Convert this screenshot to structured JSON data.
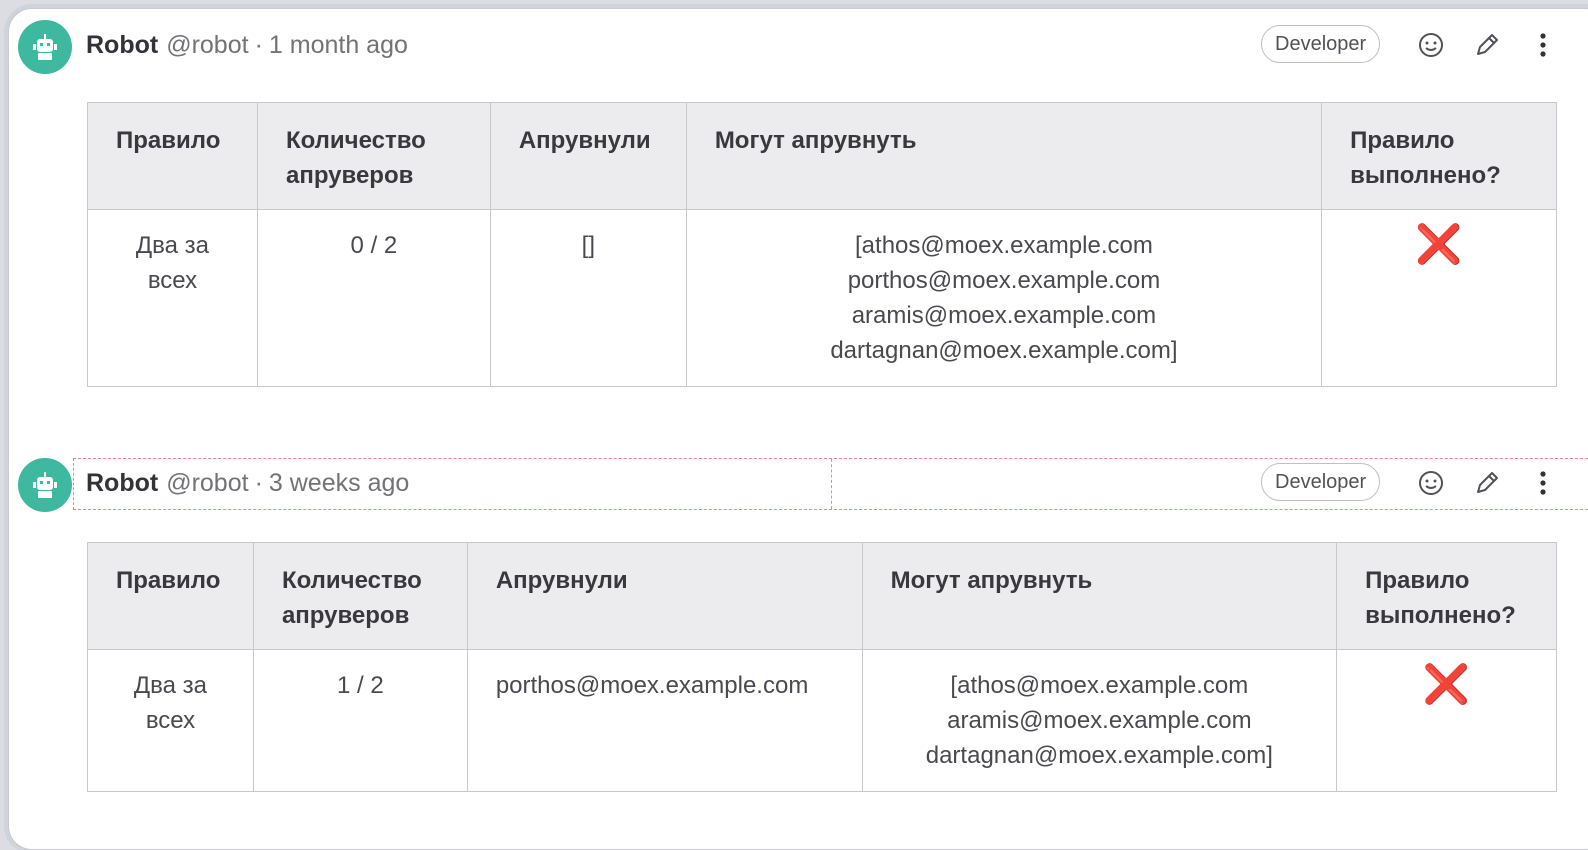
{
  "notes": [
    {
      "author": "Robot",
      "handle": "@robot",
      "separator": "·",
      "time": "1 month ago",
      "role": "Developer",
      "table": {
        "headers": [
          "Правило",
          "Количество апруверов",
          "Апрувнули",
          "Могут апрувнуть",
          "Правило выполнено?"
        ],
        "row": {
          "rule": "Два за всех",
          "count": "0 / 2",
          "approved": "[]",
          "can_approve": [
            "[athos@moex.example.com",
            "porthos@moex.example.com",
            "aramis@moex.example.com",
            "dartagnan@moex.example.com]"
          ],
          "done": "❌"
        }
      }
    },
    {
      "author": "Robot",
      "handle": "@robot",
      "separator": "·",
      "time": "3 weeks ago",
      "role": "Developer",
      "table": {
        "headers": [
          "Правило",
          "Количество апруверов",
          "Апрувнули",
          "Могут апрувнуть",
          "Правило выполнено?"
        ],
        "row": {
          "rule": "Два за всех",
          "count": "1 / 2",
          "approved": "porthos@moex.example.com",
          "can_approve": [
            "[athos@moex.example.com",
            "aramis@moex.example.com",
            "dartagnan@moex.example.com]"
          ],
          "done": "❌"
        }
      }
    }
  ],
  "colors": {
    "avatar": "#3fb8a0",
    "cross": "#d93b1d",
    "header_bg": "#ececef"
  },
  "icons": [
    "robot-avatar-icon",
    "emoji-icon",
    "pencil-icon",
    "more-vertical-icon"
  ]
}
